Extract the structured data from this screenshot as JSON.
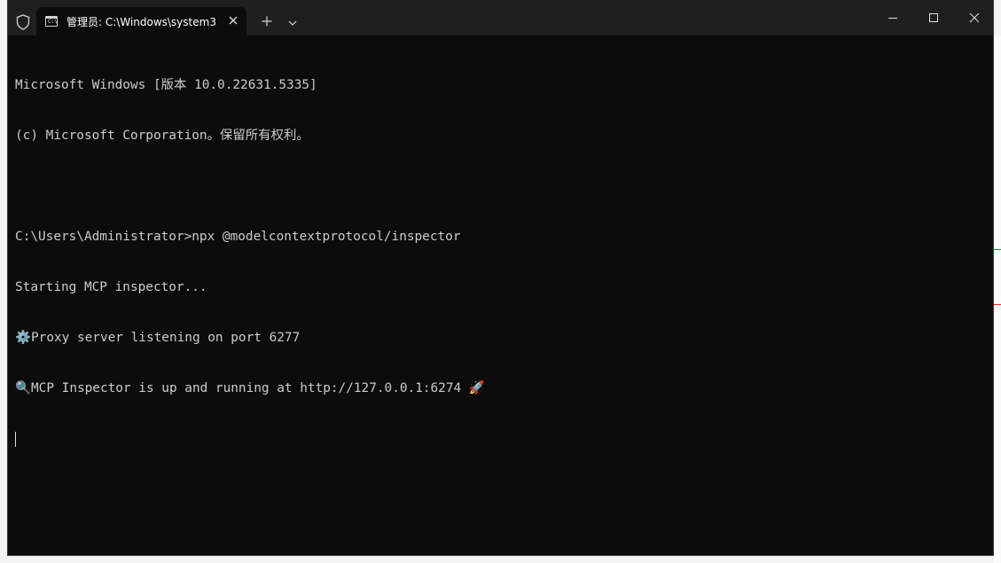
{
  "window": {
    "tab_title": "管理员:  C:\\Windows\\system3",
    "tab_icon_glyph": "C:\\",
    "new_tab_label": "+",
    "dropdown_label": "⌄"
  },
  "console": {
    "lines": [
      "Microsoft Windows [版本 10.0.22631.5335]",
      "(c) Microsoft Corporation。保留所有权利。",
      "",
      "C:\\Users\\Administrator>npx @modelcontextprotocol/inspector",
      "Starting MCP inspector...",
      "Proxy server listening on port 6277",
      "MCP Inspector is up and running at http://127.0.0.1:6274"
    ],
    "proxy_emoji": "⚙️",
    "inspector_emoji": "🔍",
    "rocket_emoji": "🚀"
  },
  "colors": {
    "terminal_bg": "#0c0c0c",
    "titlebar_bg": "#1f1f1f",
    "text": "#cccccc"
  }
}
